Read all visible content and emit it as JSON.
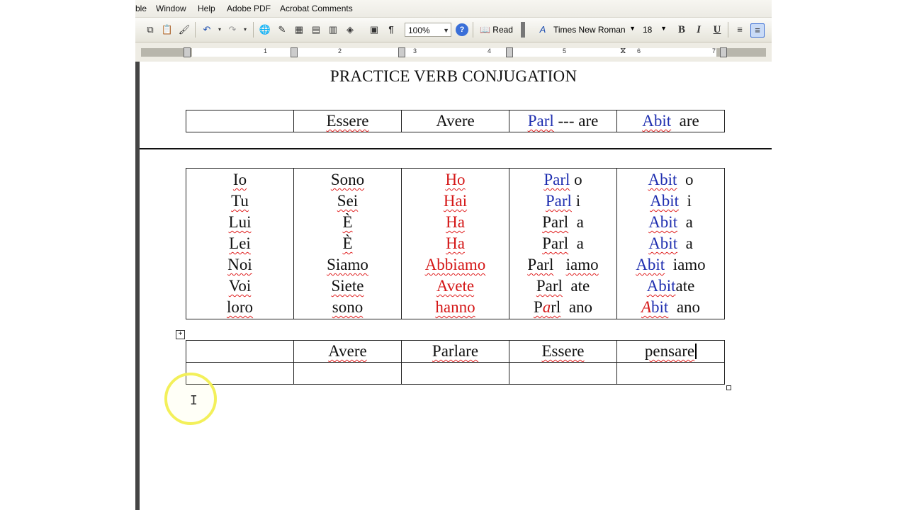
{
  "menubar": {
    "items": [
      "ble",
      "Window",
      "Help",
      "Adobe PDF",
      "Acrobat Comments"
    ]
  },
  "toolbar": {
    "zoom": "100%",
    "read_label": "Read",
    "font_name": "Times New Roman",
    "font_size": "18",
    "bold": "B",
    "italic": "I",
    "underline": "U",
    "paragraph_mark": "¶"
  },
  "ruler": {
    "numbers": [
      "1",
      "2",
      "3",
      "4",
      "5",
      "6",
      "7"
    ]
  },
  "document": {
    "title": "PRACTICE VERB CONJUGATION",
    "header_row": {
      "c2": "Essere",
      "c3": "Avere",
      "c4_stem": "Parl",
      "c4_sep": " --- ",
      "c4_end": "are",
      "c5_stem": "Abit",
      "c5_end": "are"
    },
    "conjugation": {
      "pronouns": [
        "Io",
        "Tu",
        "Lui",
        "Lei",
        "Noi",
        "Voi",
        "loro"
      ],
      "essere": [
        "Sono",
        "Sei",
        "È",
        "È",
        "Siamo",
        "Siete",
        "sono"
      ],
      "avere": [
        "Ho",
        "Hai",
        "Ha",
        "Ha",
        "Abbiamo",
        "Avete",
        "hanno"
      ],
      "parl_stem": "Parl",
      "parl_endings": [
        "o",
        "i",
        "a",
        "a",
        "iamo",
        "ate",
        "ano"
      ],
      "abit_stem": "Abit",
      "abit_endings": [
        "o",
        "i",
        "a",
        "a",
        "iamo",
        "ate",
        "ano"
      ],
      "last_row_parl_parts": [
        "P",
        "a",
        "rl"
      ],
      "last_row_abit_parts": [
        "A",
        "bit"
      ]
    },
    "table3": {
      "headers": [
        "",
        "Avere",
        "Parlare",
        "Essere",
        "pensare"
      ]
    }
  },
  "colors": {
    "stem_blue": "#1f2fb0",
    "avere_red": "#d41616",
    "spell_squiggle": "#e02020",
    "cursor_highlight": "#f3f05a"
  }
}
